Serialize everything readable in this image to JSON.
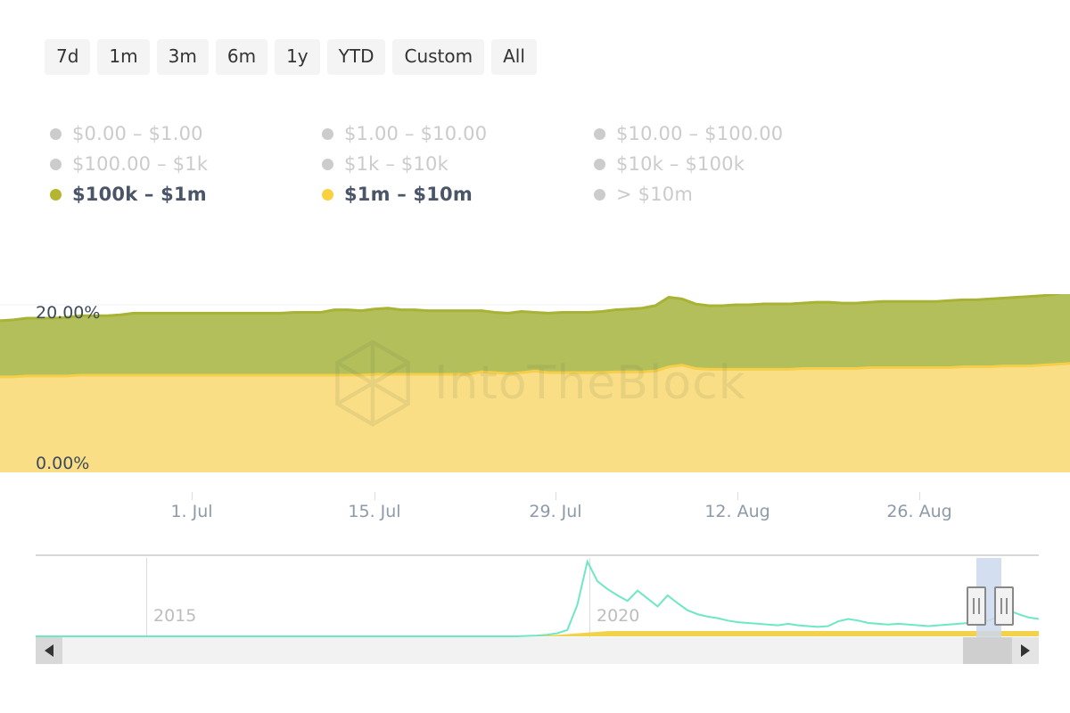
{
  "range_selector": {
    "buttons": [
      {
        "label": "7d"
      },
      {
        "label": "1m"
      },
      {
        "label": "3m"
      },
      {
        "label": "6m"
      },
      {
        "label": "1y"
      },
      {
        "label": "YTD"
      },
      {
        "label": "Custom"
      },
      {
        "label": "All"
      }
    ]
  },
  "legend": {
    "items": [
      {
        "label": "$0.00 – $1.00",
        "color": "#cccccc",
        "active": false
      },
      {
        "label": "$1.00 – $10.00",
        "color": "#cccccc",
        "active": false
      },
      {
        "label": "$10.00 – $100.00",
        "color": "#cccccc",
        "active": false
      },
      {
        "label": "$100.00 – $1k",
        "color": "#cccccc",
        "active": false
      },
      {
        "label": "$1k – $10k",
        "color": "#cccccc",
        "active": false
      },
      {
        "label": "$10k – $100k",
        "color": "#cccccc",
        "active": false
      },
      {
        "label": "$100k – $1m",
        "color": "#b5b530",
        "active": true
      },
      {
        "label": "$1m – $10m",
        "color": "#f8d13e",
        "active": true
      },
      {
        "label": "> $10m",
        "color": "#cccccc",
        "active": false
      }
    ]
  },
  "watermark": {
    "text": "IntoTheBlock"
  },
  "navigator": {
    "year_labels": [
      {
        "text": "2015",
        "x": 128
      },
      {
        "text": "2020",
        "x": 625
      }
    ],
    "gridlines_x": [
      124,
      621
    ],
    "selection": {
      "x": 1055,
      "width": 28
    },
    "handles": [
      {
        "x": 1044
      },
      {
        "x": 1072
      }
    ],
    "scrollbar": {
      "thumb_x": 1040,
      "thumb_width": 55
    }
  },
  "chart_data": {
    "type": "area",
    "title": "",
    "xlabel": "",
    "ylabel": "",
    "stacked": true,
    "grid": true,
    "legend_position": "top",
    "ylim": [
      0,
      20
    ],
    "ytick_labels": [
      "20.00%",
      "0.00%"
    ],
    "ytick_values": [
      20,
      0
    ],
    "xtick_labels": [
      "1. Jul",
      "15. Jul",
      "29. Jul",
      "12. Aug",
      "26. Aug"
    ],
    "xtick_positions": [
      215,
      420,
      623,
      827,
      1031
    ],
    "x": [
      0,
      1,
      2,
      3,
      4,
      5,
      6,
      7,
      8,
      9,
      10,
      11,
      12,
      13,
      14,
      15,
      16,
      17,
      18,
      19,
      20,
      21,
      22,
      23,
      24,
      25,
      26,
      27,
      28,
      29,
      30,
      31,
      32,
      33,
      34,
      35,
      36,
      37,
      38,
      39,
      40,
      41,
      42,
      43,
      44,
      45,
      46,
      47,
      48,
      49,
      50,
      51,
      52,
      53,
      54,
      55,
      56,
      57,
      58,
      59,
      60,
      61,
      62,
      63,
      64,
      65,
      66,
      67,
      68,
      69,
      70,
      71,
      72,
      73,
      74,
      75,
      76,
      77,
      78,
      79,
      80
    ],
    "series": [
      {
        "name": "$1m – $10m",
        "color": "#fade85",
        "stroke": "#f5cf4a",
        "values": [
          11.4,
          11.4,
          11.5,
          11.5,
          11.5,
          11.5,
          11.6,
          11.6,
          11.6,
          11.6,
          11.6,
          11.6,
          11.6,
          11.6,
          11.6,
          11.6,
          11.6,
          11.6,
          11.6,
          11.6,
          11.6,
          11.6,
          11.6,
          11.6,
          11.6,
          11.6,
          11.6,
          11.6,
          11.7,
          11.7,
          11.7,
          11.7,
          11.7,
          11.7,
          11.7,
          11.7,
          12.0,
          11.9,
          11.8,
          11.9,
          12.1,
          11.9,
          11.9,
          11.9,
          11.9,
          11.9,
          12.0,
          12.0,
          12.0,
          12.1,
          12.6,
          12.8,
          12.4,
          12.3,
          12.3,
          12.3,
          12.3,
          12.3,
          12.3,
          12.3,
          12.4,
          12.4,
          12.4,
          12.4,
          12.4,
          12.5,
          12.5,
          12.5,
          12.5,
          12.5,
          12.5,
          12.5,
          12.6,
          12.6,
          12.6,
          12.7,
          12.7,
          12.7,
          12.8,
          12.9,
          13.0
        ]
      },
      {
        "name": "$100k – $1m",
        "color": "#b3bf5a",
        "stroke": "#a8b335",
        "values": [
          6.7,
          6.8,
          6.9,
          6.9,
          6.9,
          7.0,
          7.1,
          7.1,
          7.1,
          7.2,
          7.4,
          7.4,
          7.4,
          7.4,
          7.4,
          7.4,
          7.4,
          7.4,
          7.4,
          7.4,
          7.4,
          7.4,
          7.5,
          7.5,
          7.5,
          7.8,
          7.8,
          7.7,
          7.8,
          7.9,
          7.7,
          7.7,
          7.6,
          7.6,
          7.6,
          7.6,
          7.3,
          7.2,
          7.2,
          7.3,
          7.0,
          7.1,
          7.2,
          7.2,
          7.2,
          7.3,
          7.4,
          7.5,
          7.6,
          7.8,
          8.3,
          7.9,
          7.7,
          7.6,
          7.6,
          7.7,
          7.7,
          7.8,
          7.8,
          7.8,
          7.8,
          7.9,
          7.9,
          7.8,
          7.8,
          7.8,
          7.9,
          7.9,
          7.9,
          7.9,
          7.9,
          8.0,
          8.0,
          8.0,
          8.1,
          8.1,
          8.2,
          8.3,
          8.3,
          8.4,
          8.6
        ]
      }
    ],
    "navigator_series": [
      {
        "name": "navigator-main",
        "color": "#6ee7c5",
        "values": [
          0,
          0,
          0,
          0,
          0,
          0,
          0,
          0,
          0,
          0,
          0,
          0,
          0,
          0,
          0,
          0,
          0,
          0,
          0,
          0,
          0,
          0,
          0,
          0,
          0,
          0,
          0,
          0,
          0,
          0,
          0,
          0,
          0,
          0,
          0,
          0,
          0,
          0,
          0,
          0,
          0,
          0,
          0,
          0,
          0,
          0,
          0,
          0,
          0,
          0.5,
          1,
          2,
          4,
          8,
          40,
          95,
          70,
          60,
          52,
          45,
          58,
          48,
          38,
          52,
          42,
          33,
          28,
          25,
          23,
          20,
          18,
          17,
          16,
          15,
          14,
          16,
          14,
          13,
          12,
          13,
          19,
          22,
          20,
          17,
          16,
          15,
          16,
          15,
          14,
          13,
          14,
          15,
          16,
          17,
          18,
          20,
          25,
          33,
          28,
          24,
          22
        ]
      }
    ]
  }
}
